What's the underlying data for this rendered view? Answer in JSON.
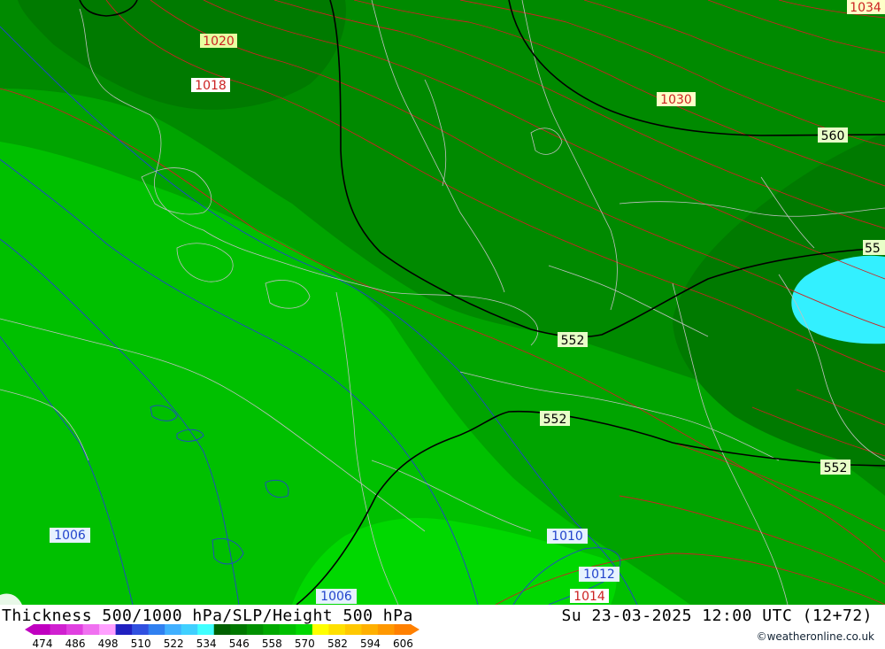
{
  "title": "Thickness 500/1000 hPa/SLP/Height 500 hPa",
  "run_time": "Su 23-03-2025 12:00 UTC (12+72)",
  "credit": "©weatheronline.co.uk",
  "colors": {
    "band_546": "#008a00",
    "band_552": "#00a400",
    "band_558": "#00c000",
    "band_564": "#00d800",
    "band_534": "#007000",
    "cold_core": "#33f0ff",
    "slp_high": "#cc2222",
    "slp_low": "#2222cc",
    "height_contour": "#000000",
    "borders": "#b8b8b8"
  },
  "legend": {
    "ticks": [
      "474",
      "486",
      "498",
      "510",
      "522",
      "534",
      "546",
      "558",
      "570",
      "582",
      "594",
      "606"
    ],
    "colors": [
      "#c000c0",
      "#d020d0",
      "#e040e0",
      "#f070f0",
      "#ffa0ff",
      "#2020c0",
      "#3050e0",
      "#3080f0",
      "#40b0ff",
      "#40d0ff",
      "#40ffff",
      "#006000",
      "#007800",
      "#009000",
      "#00a800",
      "#00c000",
      "#00d800",
      "#ffff00",
      "#ffe000",
      "#ffc800",
      "#ffb000",
      "#ff9800",
      "#ff8000"
    ]
  },
  "height_labels": [
    {
      "text": "560"
    },
    {
      "text": "552"
    },
    {
      "text": "552"
    },
    {
      "text": "552"
    },
    {
      "text": "55"
    }
  ],
  "slp_high_labels": [
    {
      "text": "1020"
    },
    {
      "text": "1018"
    },
    {
      "text": "1030"
    },
    {
      "text": "1034"
    },
    {
      "text": "1014"
    }
  ],
  "slp_low_labels": [
    {
      "text": "1006"
    },
    {
      "text": "1010"
    },
    {
      "text": "1012"
    },
    {
      "text": "1006"
    }
  ]
}
